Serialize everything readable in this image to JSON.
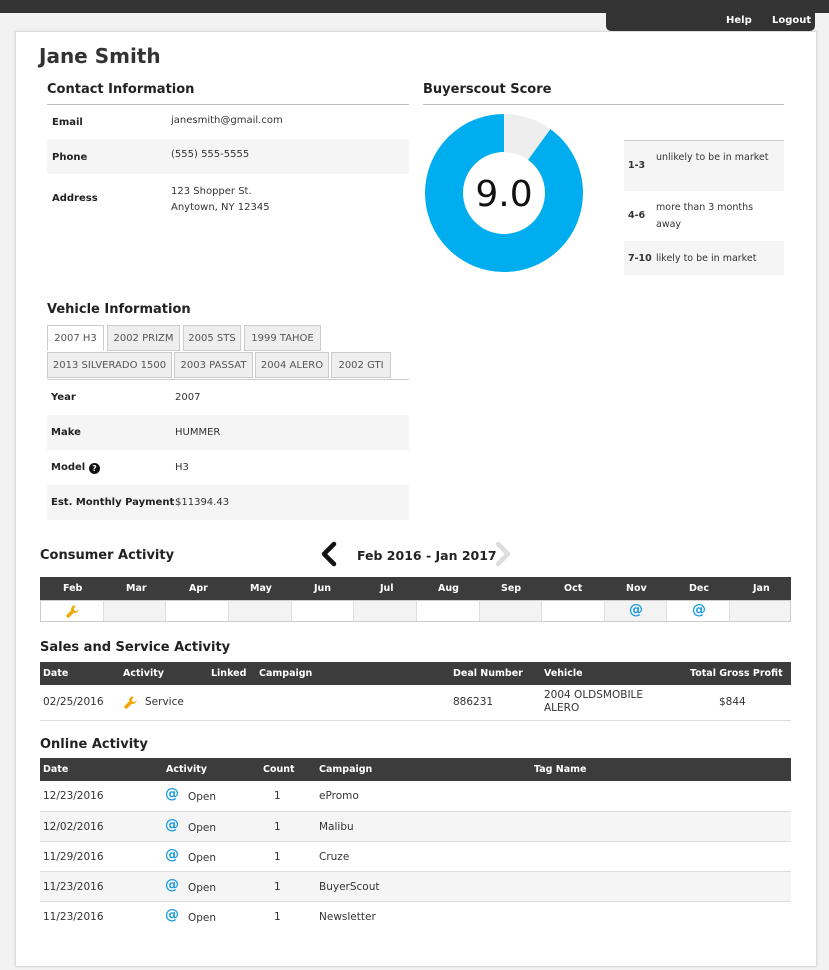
{
  "nav": {
    "help": "Help",
    "logout": "Logout"
  },
  "customer": {
    "name": "Jane Smith"
  },
  "contact": {
    "title": "Contact Information",
    "email_label": "Email",
    "email": "janesmith@gmail.com",
    "phone_label": "Phone",
    "phone": "(555) 555-5555",
    "address_label": "Address",
    "address_line1": "123 Shopper St.",
    "address_line2": "Anytown, NY 12345"
  },
  "score": {
    "title": "Buyerscout Score",
    "value": "9.0",
    "fraction": 0.9,
    "ring_color": "#00aeef",
    "remainder_color": "#eeeeee",
    "legend": [
      {
        "range": "1-3",
        "desc": "unlikely to be in market"
      },
      {
        "range": "4-6",
        "desc": "more than 3 months away"
      },
      {
        "range": "7-10",
        "desc": "likely to be in market"
      }
    ]
  },
  "vehicle": {
    "title": "Vehicle Information",
    "tabs": [
      "2007 H3",
      "2002 PRIZM",
      "2005 STS",
      "1999 TAHOE",
      "2013 SILVERADO 1500",
      "2003 PASSAT",
      "2004 ALERO",
      "2002 GTI"
    ],
    "year_label": "Year",
    "year": "2007",
    "make_label": "Make",
    "make": "HUMMER",
    "model_label": "Model",
    "model": "H3",
    "payment_label": "Est. Monthly Payment",
    "payment": "$11394.43"
  },
  "consumer_activity": {
    "title": "Consumer Activity",
    "range": "Feb 2016 - Jan 2017",
    "months": [
      "Feb",
      "Mar",
      "Apr",
      "May",
      "Jun",
      "Jul",
      "Aug",
      "Sep",
      "Oct",
      "Nov",
      "Dec",
      "Jan"
    ],
    "icons": [
      "wrench-icon",
      "",
      "",
      "",
      "",
      "",
      "",
      "",
      "",
      "at-icon",
      "at-icon",
      ""
    ],
    "wrench_color": "#f0a800",
    "at_color": "#1a9be0"
  },
  "sales": {
    "title": "Sales and Service Activity",
    "headers": {
      "date": "Date",
      "activity": "Activity",
      "linked": "Linked",
      "campaign": "Campaign",
      "deal": "Deal Number",
      "vehicle": "Vehicle",
      "profit": "Total Gross Profit"
    },
    "rows": [
      {
        "date": "02/25/2016",
        "activity": "Service",
        "deal": "886231",
        "vehicle_line1": "2004 OLDSMOBILE",
        "vehicle_line2": "ALERO",
        "profit": "$844"
      }
    ]
  },
  "online": {
    "title": "Online Activity",
    "headers": {
      "date": "Date",
      "activity": "Activity",
      "count": "Count",
      "campaign": "Campaign",
      "tag": "Tag Name"
    },
    "rows": [
      {
        "date": "12/23/2016",
        "activity": "Open",
        "count": "1",
        "campaign": "ePromo"
      },
      {
        "date": "12/02/2016",
        "activity": "Open",
        "count": "1",
        "campaign": "Malibu"
      },
      {
        "date": "11/29/2016",
        "activity": "Open",
        "count": "1",
        "campaign": "Cruze"
      },
      {
        "date": "11/23/2016",
        "activity": "Open",
        "count": "1",
        "campaign": "BuyerScout"
      },
      {
        "date": "11/23/2016",
        "activity": "Open",
        "count": "1",
        "campaign": "Newsletter"
      }
    ]
  }
}
